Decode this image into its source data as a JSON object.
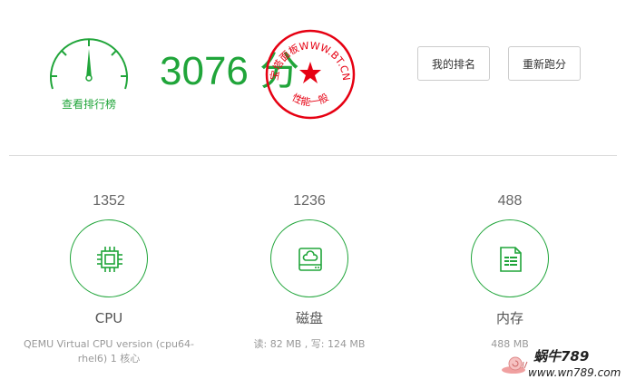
{
  "header": {
    "rank_link": "查看排行榜",
    "total_score": "3076 分",
    "stamp_brand": "宝塔面板WWW.BT.CN",
    "stamp_level": "性能一般",
    "buttons": {
      "rank": "我的排名",
      "rerun": "重新跑分"
    }
  },
  "metrics": [
    {
      "score": "1352",
      "name": "CPU",
      "desc": "QEMU Virtual CPU version (cpu64-rhel6) 1 核心",
      "icon": "cpu-chip-icon"
    },
    {
      "score": "1236",
      "name": "磁盘",
      "desc": "读: 82 MB , 写: 124 MB",
      "icon": "disk-drive-icon"
    },
    {
      "score": "488",
      "name": "内存",
      "desc": "488 MB",
      "icon": "memory-document-icon"
    }
  ],
  "watermark": {
    "brand": "蜗牛789",
    "url": "www.wn789.com"
  },
  "colors": {
    "accent": "#20a53a",
    "stamp": "#e60012",
    "divider": "#dddddd"
  }
}
